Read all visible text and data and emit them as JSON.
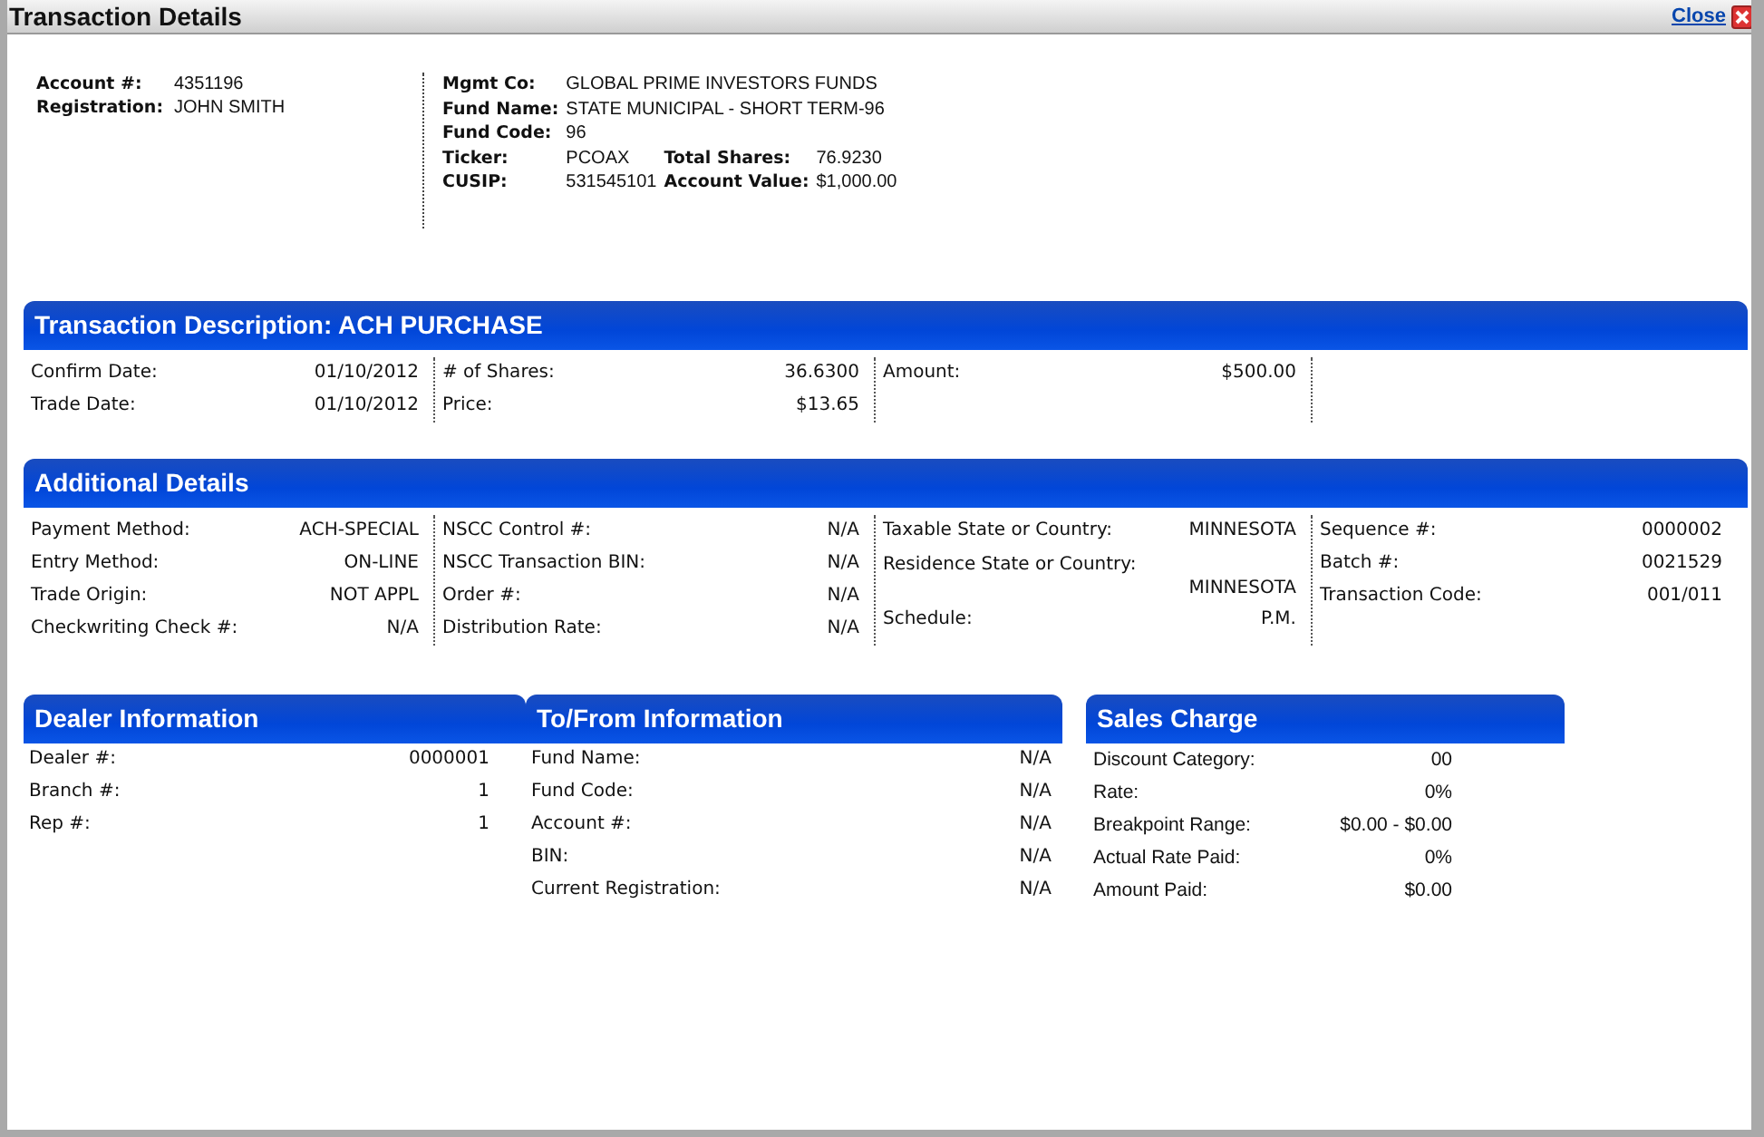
{
  "window": {
    "title": "Transaction Details",
    "close_label": "Close"
  },
  "account": [
    {
      "label": "Account #:",
      "value": "4351196"
    },
    {
      "label": "Registration:",
      "value": "JOHN SMITH"
    }
  ],
  "fund": [
    [
      {
        "label": "Mgmt Co:",
        "value": "GLOBAL PRIME INVESTORS FUNDS"
      }
    ],
    [
      {
        "label": "Fund Name:",
        "value": "STATE MUNICIPAL - SHORT TERM-96"
      }
    ],
    [
      {
        "label": "Fund Code:",
        "value": "96"
      }
    ],
    [
      {
        "label": "Ticker:",
        "value": "PCOAX"
      },
      {
        "label": "Total Shares:",
        "value": "76.9230"
      }
    ],
    [
      {
        "label": "CUSIP:",
        "value": "531545101"
      },
      {
        "label": "Account Value:",
        "value": "$1,000.00"
      }
    ]
  ],
  "sections": [
    {
      "title": "Transaction Description: ACH PURCHASE",
      "columns": [
        [
          {
            "label": "Confirm Date:",
            "value": "01/10/2012"
          },
          {
            "label": "Trade Date:",
            "value": "01/10/2012"
          }
        ],
        [
          {
            "label": "# of Shares:",
            "value": "36.6300"
          },
          {
            "label": "Price:",
            "value": "$13.65"
          }
        ],
        [
          {
            "label": "Amount:",
            "value": "$500.00"
          }
        ]
      ]
    },
    {
      "title": "Additional Details",
      "columns": [
        [
          {
            "label": "Payment Method:",
            "value": "ACH-SPECIAL"
          },
          {
            "label": "Entry Method:",
            "value": "ON-LINE"
          },
          {
            "label": "Trade Origin:",
            "value": "NOT APPL"
          },
          {
            "label": "Checkwriting Check #:",
            "value": "N/A"
          }
        ],
        [
          {
            "label": "NSCC Control #:",
            "value": "N/A"
          },
          {
            "label": "NSCC Transaction BIN:",
            "value": "N/A"
          },
          {
            "label": "Order #:",
            "value": "N/A"
          },
          {
            "label": "Distribution Rate:",
            "value": "N/A"
          }
        ],
        [
          {
            "kind": "inline",
            "label": "Taxable State or Country:",
            "value": "MINNESOTA"
          },
          {
            "kind": "stacked",
            "label": "Residence State or Country:",
            "value": "MINNESOTA"
          },
          {
            "kind": "inline",
            "label": "Schedule:",
            "value": "P.M."
          }
        ],
        [
          {
            "label": "Sequence #:",
            "value": "0000002"
          },
          {
            "label": "Batch #:",
            "value": "0021529"
          },
          {
            "label": "Transaction Code:",
            "value": "001/011"
          }
        ]
      ]
    }
  ],
  "panels": [
    {
      "title": "Dealer Information",
      "rows": [
        {
          "label": "Dealer #:",
          "value": "0000001"
        },
        {
          "label": "Branch #:",
          "value": "1"
        },
        {
          "label": "Rep #:",
          "value": "1"
        }
      ]
    },
    {
      "title": "To/From Information",
      "rows": [
        {
          "label": "Fund Name:",
          "value": "N/A"
        },
        {
          "label": "Fund Code:",
          "value": "N/A"
        },
        {
          "label": "Account #:",
          "value": "N/A"
        },
        {
          "label": "BIN:",
          "value": "N/A"
        },
        {
          "label": "Current Registration:",
          "value": "N/A"
        }
      ]
    },
    {
      "title": "Sales Charge",
      "rows": [
        {
          "label": "Discount Category:",
          "value": "00"
        },
        {
          "label": "Rate:",
          "value": "0%"
        },
        {
          "label": "Breakpoint Range:",
          "value": "$0.00 - $0.00"
        },
        {
          "label": "Actual Rate Paid:",
          "value": "0%"
        },
        {
          "label": "Amount Paid:",
          "value": "$0.00"
        }
      ]
    }
  ]
}
